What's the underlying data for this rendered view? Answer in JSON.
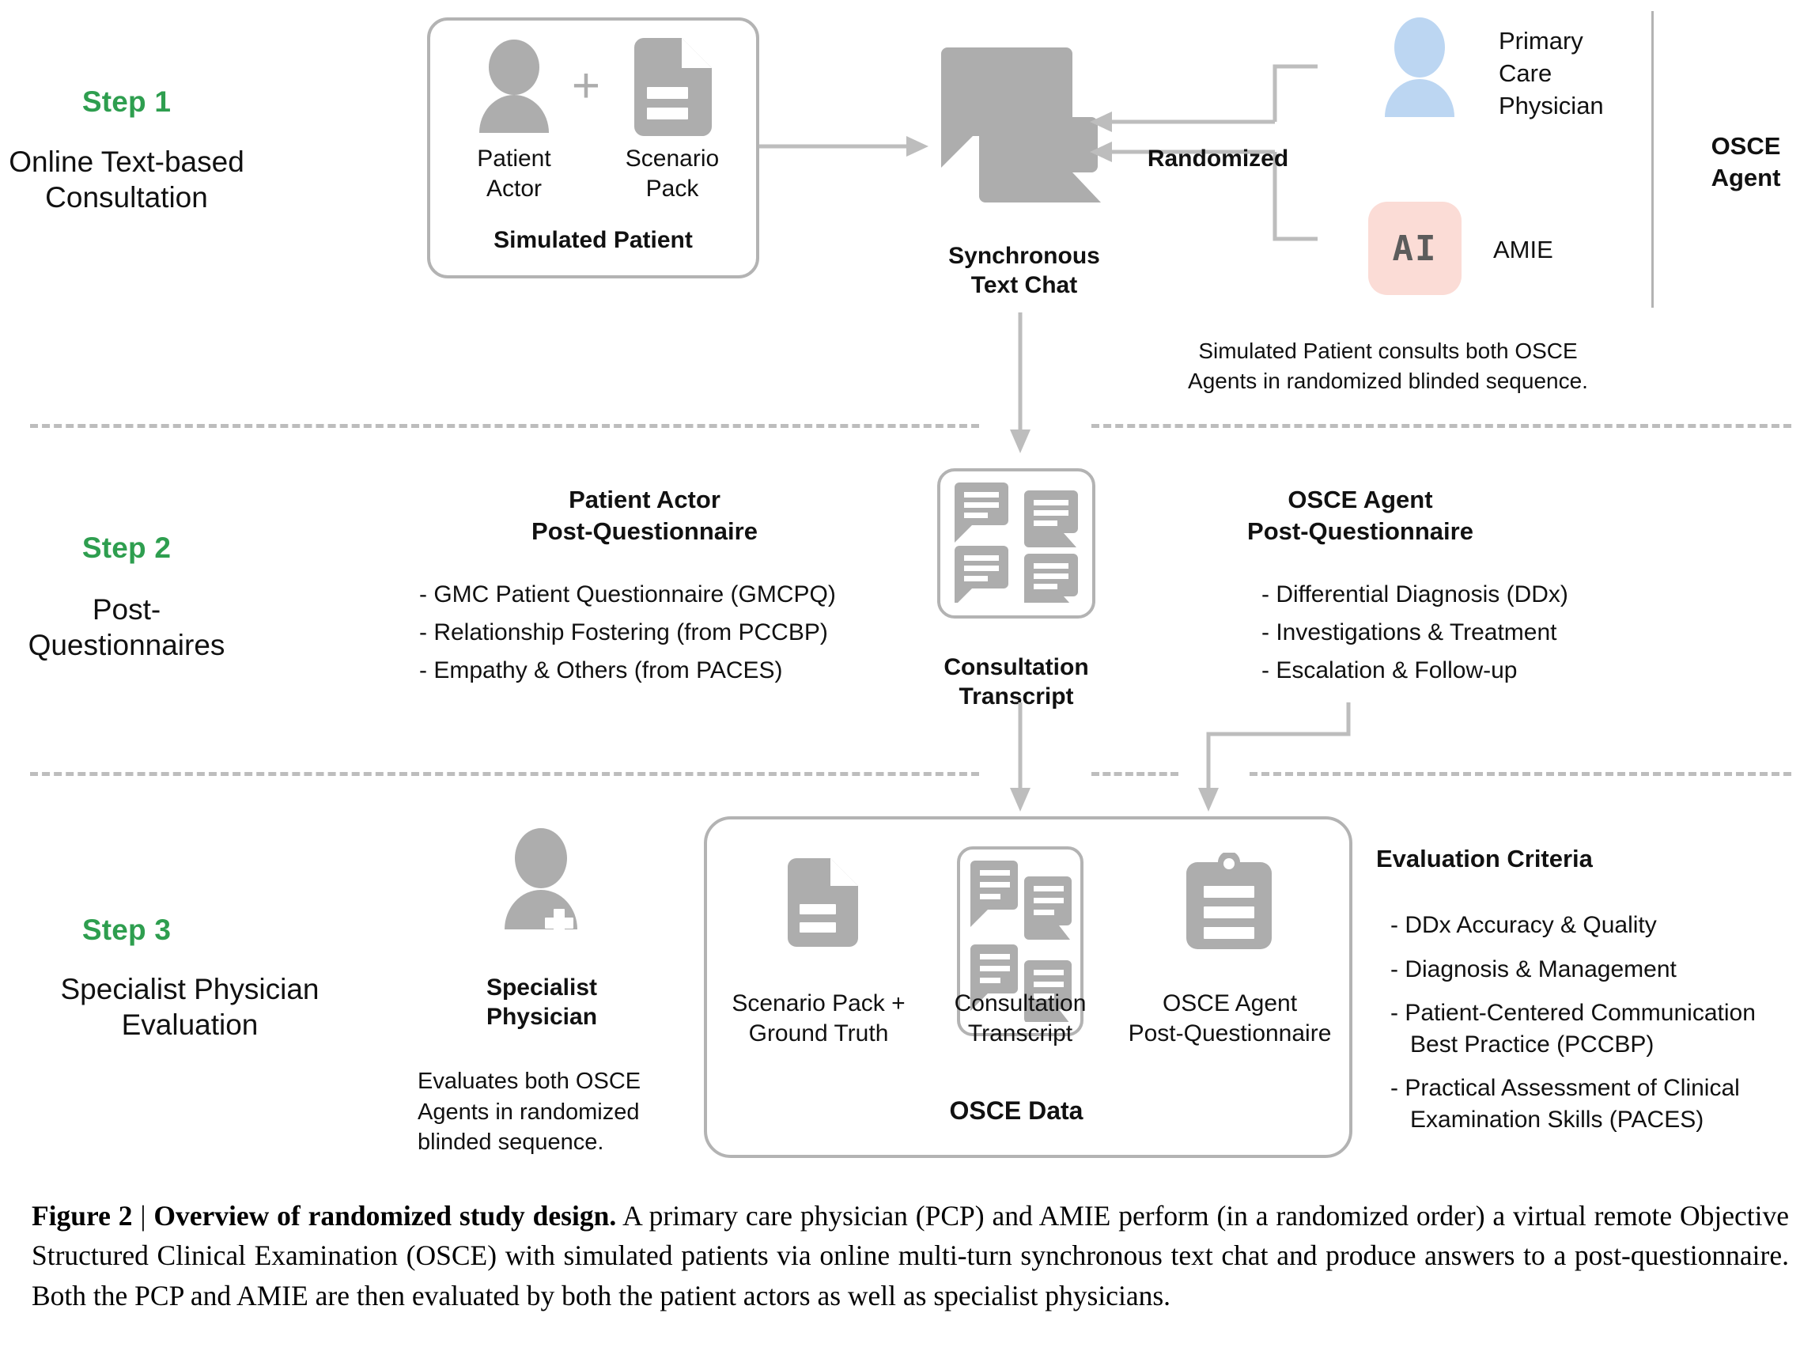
{
  "figure": {
    "caption_label": "Figure 2",
    "caption_separator": "|",
    "caption_title": "Overview of randomized study design.",
    "caption_body": " A primary care physician (PCP) and AMIE perform (in a randomized order) a virtual remote Objective Structured Clinical Examination (OSCE) with simulated patients via online multi-turn synchronous text chat and produce answers to a post-questionnaire. Both the PCP and AMIE are then evaluated by both the patient actors as well as specialist physicians."
  },
  "colors": {
    "accent_green": "#2e9e4f",
    "icon_gray": "#adadad",
    "line_gray": "#b3b3b3",
    "pcp_blue": "#bcd6f2",
    "amie_pink": "#fbdcd6"
  },
  "step1": {
    "label": "Step 1",
    "desc_line1": "Online Text-based",
    "desc_line2": "Consultation",
    "simulated_patient": {
      "box_title": "Simulated Patient",
      "items": [
        {
          "label_line1": "Patient",
          "label_line2": "Actor",
          "icon": "person-icon"
        },
        {
          "label_line1": "Scenario",
          "label_line2": "Pack",
          "icon": "document-icon"
        }
      ],
      "connector": "+"
    },
    "chat": {
      "title_line1": "Synchronous",
      "title_line2": "Text Chat",
      "icon": "speech-bubbles-icon"
    },
    "randomized_label": "Randomized",
    "osce_agent": {
      "title_line1": "OSCE",
      "title_line2": "Agent",
      "agents": [
        {
          "name_line1": "Primary",
          "name_line2": "Care",
          "name_line3": "Physician",
          "icon": "person-avatar-blue-icon"
        },
        {
          "name_line1": "AMIE",
          "chip_text": "AI",
          "icon": "ai-chip-icon"
        }
      ]
    },
    "note_line1": "Simulated Patient consults both OSCE",
    "note_line2": "Agents in randomized blinded sequence."
  },
  "step2": {
    "label": "Step 2",
    "desc_line1": "Post-Questionnaires",
    "patient_actor_questionnaire": {
      "title_line1": "Patient Actor",
      "title_line2": "Post-Questionnaire",
      "items": [
        "- GMC Patient Questionnaire (GMCPQ)",
        "- Relationship Fostering (from PCCBP)",
        "- Empathy & Others (from PACES)"
      ]
    },
    "transcript": {
      "title_line1": "Consultation",
      "title_line2": "Transcript",
      "icon": "transcript-bubbles-icon"
    },
    "osce_agent_questionnaire": {
      "title_line1": "OSCE Agent",
      "title_line2": "Post-Questionnaire",
      "items": [
        "- Differential Diagnosis (DDx)",
        "- Investigations & Treatment",
        "- Escalation & Follow-up"
      ]
    }
  },
  "step3": {
    "label": "Step 3",
    "desc_line1": "Specialist Physician",
    "desc_line2": "Evaluation",
    "specialist": {
      "title_line1": "Specialist",
      "title_line2": "Physician",
      "icon": "physician-plus-icon",
      "note_line1": "Evaluates both OSCE",
      "note_line2": "Agents in randomized",
      "note_line3": "blinded sequence."
    },
    "osce_data": {
      "box_title": "OSCE Data",
      "items": [
        {
          "label_line1": "Scenario Pack +",
          "label_line2": "Ground Truth",
          "icon": "document-icon"
        },
        {
          "label_line1": "Consultation",
          "label_line2": "Transcript",
          "icon": "transcript-bubbles-icon"
        },
        {
          "label_line1": "OSCE Agent",
          "label_line2": "Post-Questionnaire",
          "icon": "clipboard-icon"
        }
      ]
    },
    "evaluation_criteria": {
      "title": "Evaluation Criteria",
      "items": [
        "- DDx Accuracy & Quality",
        "- Diagnosis & Management",
        "- Patient-Centered Communication\n   Best Practice (PCCBP)",
        "- Practical Assessment of Clinical\n   Examination Skills (PACES)"
      ]
    }
  }
}
